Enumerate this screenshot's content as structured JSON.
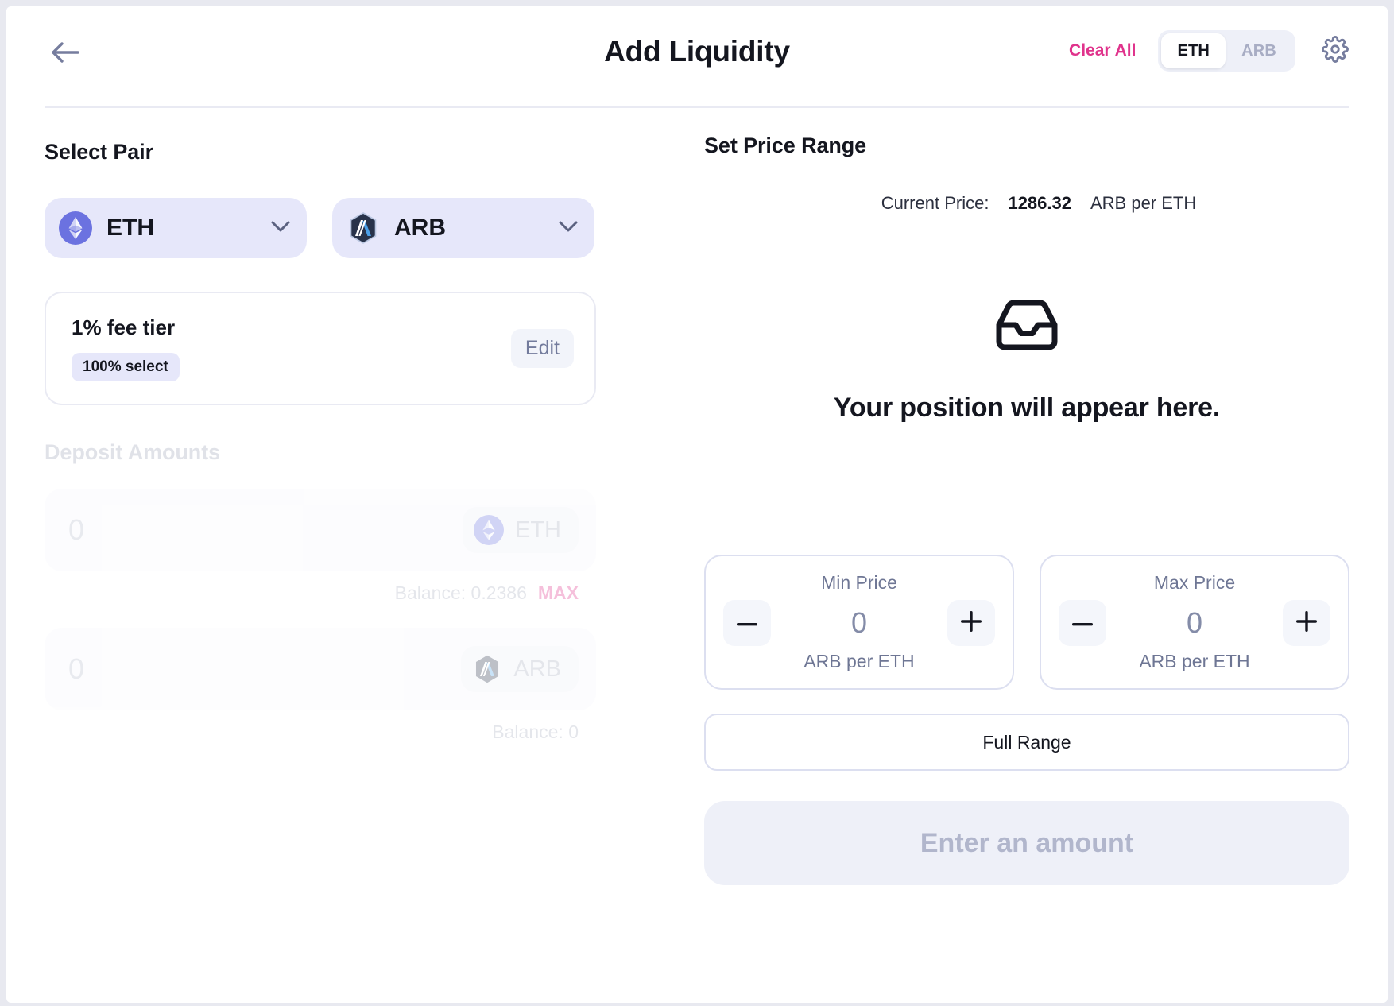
{
  "header": {
    "back_icon": "arrow-left-icon",
    "title": "Add Liquidity",
    "clear_all": "Clear All",
    "toggle": {
      "options": [
        "ETH",
        "ARB"
      ],
      "selected": "ETH"
    },
    "settings_icon": "gear-icon"
  },
  "select_pair": {
    "title": "Select Pair",
    "tokens": [
      {
        "symbol": "ETH",
        "icon": "eth-token-icon"
      },
      {
        "symbol": "ARB",
        "icon": "arb-token-icon"
      }
    ]
  },
  "fee_tier": {
    "title": "1% fee tier",
    "badge": "100% select",
    "edit_label": "Edit"
  },
  "deposit": {
    "title": "Deposit Amounts",
    "rows": [
      {
        "amount": "0",
        "symbol": "ETH",
        "icon": "eth-token-icon",
        "balance_label": "Balance: 0.2386",
        "max_label": "MAX"
      },
      {
        "amount": "0",
        "symbol": "ARB",
        "icon": "arb-token-icon",
        "balance_label": "Balance: 0",
        "max_label": ""
      }
    ]
  },
  "price_range": {
    "title": "Set Price Range",
    "current_price_label": "Current Price:",
    "current_price_value": "1286.32",
    "current_price_unit": "ARB per ETH",
    "empty_state": {
      "icon": "inbox-icon",
      "text": "Your position will appear here."
    },
    "min": {
      "label": "Min Price",
      "value": "0",
      "unit": "ARB per ETH",
      "minus": "−",
      "plus": "+"
    },
    "max": {
      "label": "Max Price",
      "value": "0",
      "unit": "ARB per ETH",
      "minus": "−",
      "plus": "+"
    },
    "full_range_label": "Full Range",
    "submit_label": "Enter an amount"
  },
  "colors": {
    "accent_pink": "#e0338c",
    "token_pill": "#e6e7fa",
    "text_dark": "#14161f",
    "muted": "#6e7694"
  }
}
